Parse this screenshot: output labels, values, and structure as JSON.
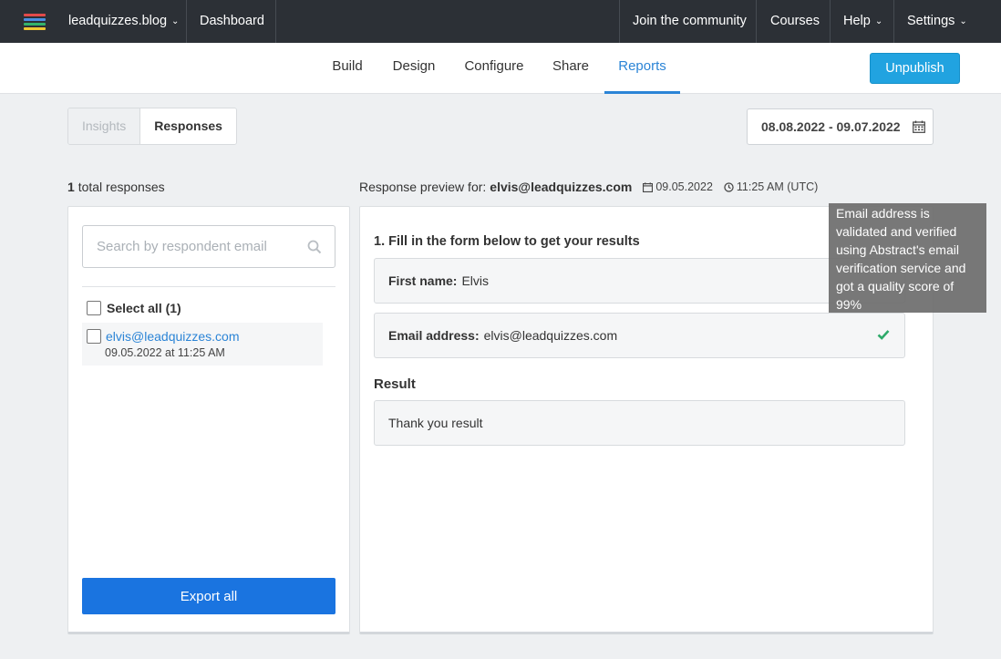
{
  "topbar": {
    "workspace": "leadquizzes.blog",
    "dashboard": "Dashboard",
    "community": "Join the community",
    "courses": "Courses",
    "help": "Help",
    "settings": "Settings"
  },
  "subnav": {
    "tabs": [
      "Build",
      "Design",
      "Configure",
      "Share",
      "Reports"
    ],
    "active_tab": "Reports",
    "unpublish_label": "Unpublish"
  },
  "view_toggle": {
    "insights": "Insights",
    "responses": "Responses"
  },
  "date_range": "08.08.2022 - 09.07.2022",
  "summary": {
    "count": "1",
    "label": "total responses"
  },
  "left_panel": {
    "search_placeholder": "Search by respondent email",
    "select_all": "Select all (1)",
    "responses": [
      {
        "email": "elvis@leadquizzes.com",
        "date": "09.05.2022 at 11:25 AM"
      }
    ],
    "export_label": "Export all"
  },
  "preview": {
    "label": "Response preview for:",
    "email": "elvis@leadquizzes.com",
    "date": "09.05.2022",
    "time": "11:25 AM (UTC)",
    "question": "1. Fill in the form below to get your results",
    "fields": [
      {
        "label": "First name:",
        "value": "Elvis"
      },
      {
        "label": "Email address:",
        "value": "elvis@leadquizzes.com"
      }
    ],
    "result_title": "Result",
    "result_value": "Thank you result"
  },
  "tooltip": "Email address is validated and verified using Abstract's email verification service and got a quality score of 99%",
  "colors": {
    "accent": "#2b84d6",
    "topbar": "#2c3036",
    "unpublish": "#21a3e0",
    "export": "#1a74e0",
    "check": "#2eaa6a"
  }
}
